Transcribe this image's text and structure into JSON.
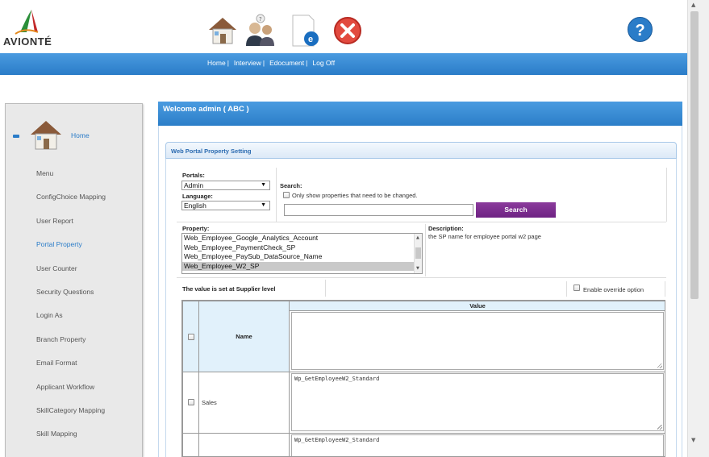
{
  "brand": {
    "logo_text": "AVIONTÉ"
  },
  "nav": {
    "links": [
      "Home",
      "Interview",
      "Edocument",
      "Log Off"
    ],
    "separator": "|"
  },
  "sidebar": {
    "home_label": "Home",
    "items": [
      {
        "label": "Menu"
      },
      {
        "label": "ConfigChoice Mapping"
      },
      {
        "label": "User Report"
      },
      {
        "label": "Portal Property",
        "active": true
      },
      {
        "label": "User Counter"
      },
      {
        "label": "Security Questions"
      },
      {
        "label": "Login As"
      },
      {
        "label": "Branch Property"
      },
      {
        "label": "Email Format"
      },
      {
        "label": "Applicant Workflow"
      },
      {
        "label": "SkillCategory Mapping"
      },
      {
        "label": "Skill Mapping"
      }
    ]
  },
  "main": {
    "welcome": "Welcome admin ( ABC )",
    "panel_title": "Web Portal Property Setting",
    "portals_label": "Portals:",
    "portals_value": "Admin",
    "language_label": "Language:",
    "language_value": "English",
    "search_label": "Search:",
    "search_checkbox_label": "Only show properties that need to be changed.",
    "search_value": "",
    "search_button": "Search",
    "property_label": "Property:",
    "property_options": [
      "Web_Employee_Google_Analytics_Account",
      "Web_Employee_PaymentCheck_SP",
      "Web_Employee_PaySub_DataSource_Name",
      "Web_Employee_W2_SP"
    ],
    "property_selected_index": 3,
    "description_label": "Description:",
    "description_text": "the SP name for employee portal w2 page",
    "level_text": "The value is set at Supplier level",
    "override_label": "Enable override option",
    "table": {
      "col_name": "Name",
      "col_value": "Value",
      "rows": [
        {
          "name": "Sales",
          "value": "Wp_GetEmployeeW2_Standard"
        },
        {
          "name": "",
          "value": "Wp_GetEmployeeW2_Standard"
        }
      ]
    }
  },
  "colors": {
    "accent_blue": "#2a7cc8",
    "search_button": "#7a2b8e",
    "table_header": "#e1f1fb"
  }
}
